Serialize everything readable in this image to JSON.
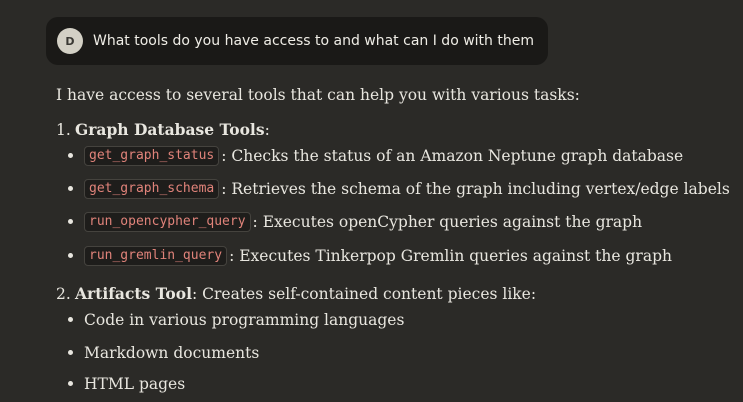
{
  "user_message": {
    "avatar_initial": "D",
    "text": "What tools do you have access to and what can I do with them"
  },
  "reply": {
    "intro": "I have access to several tools that can help you with various tasks:",
    "sections": [
      {
        "number": "1.",
        "title": "Graph Database Tools",
        "suffix": ":",
        "items": [
          {
            "code": "get_graph_status",
            "text": ": Checks the status of an Amazon Neptune graph database"
          },
          {
            "code": "get_graph_schema",
            "text": ": Retrieves the schema of the graph including vertex/edge labels"
          },
          {
            "code": "run_opencypher_query",
            "text": ": Executes openCypher queries against the graph"
          },
          {
            "code": "run_gremlin_query",
            "text": ": Executes Tinkerpop Gremlin queries against the graph"
          }
        ]
      },
      {
        "number": "2.",
        "title": "Artifacts Tool",
        "suffix": ": Creates self-contained content pieces like:",
        "items": [
          {
            "text": "Code in various programming languages"
          },
          {
            "text": "Markdown documents"
          },
          {
            "text": "HTML pages"
          }
        ]
      }
    ]
  }
}
